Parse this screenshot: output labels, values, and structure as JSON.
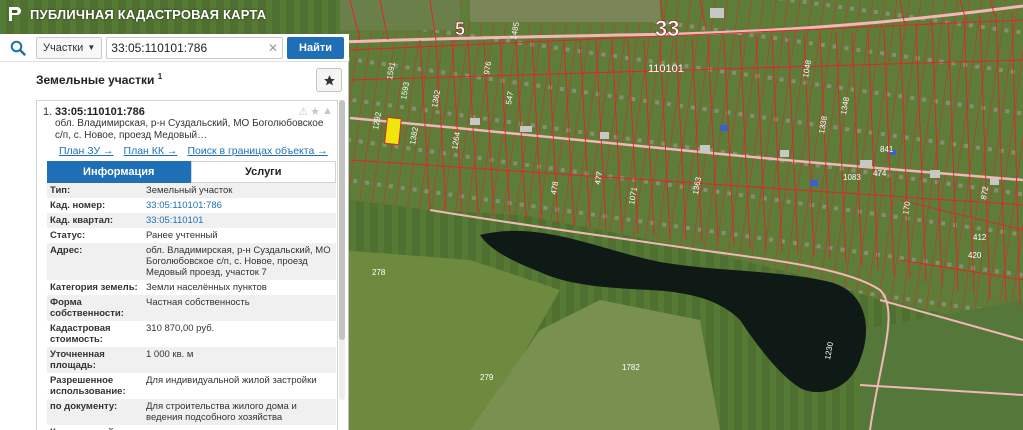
{
  "app": {
    "title": "ПУБЛИЧНАЯ КАДАСТРОВАЯ КАРТА"
  },
  "search": {
    "type_label": "Участки",
    "query": "33:05:110101:786",
    "find_label": "Найти"
  },
  "panel": {
    "title": "Земельные участки",
    "title_count": "1"
  },
  "result": {
    "number": "1.",
    "cad_number": "33:05:110101:786",
    "address": "обл. Владимирская, р-н Суздальский, МО Боголюбовское с/п, с. Новое, проезд Медовый…",
    "links": [
      "План ЗУ →",
      "План КК →",
      "Поиск в границах объекта →"
    ],
    "tabs": [
      "Информация",
      "Услуги"
    ],
    "attributes": [
      {
        "k": "Тип:",
        "v": "Земельный участок"
      },
      {
        "k": "Кад. номер:",
        "v": "33:05:110101:786",
        "link": true
      },
      {
        "k": "Кад. квартал:",
        "v": "33:05:110101",
        "link": true
      },
      {
        "k": "Статус:",
        "v": "Ранее учтенный"
      },
      {
        "k": "Адрес:",
        "v": "обл. Владимирская, р-н Суздальский, МО Боголюбовское с/п, с. Новое, проезд Медовый проезд, участок 7"
      },
      {
        "k": "Категория земель:",
        "v": "Земли населённых пунктов"
      },
      {
        "k": "Форма собственности:",
        "v": "Частная собственность"
      },
      {
        "k": "Кадастровая стоимость:",
        "v": "310 870,00 руб."
      },
      {
        "k": "Уточненная площадь:",
        "v": "1 000 кв. м"
      },
      {
        "k": "Разрешенное использование:",
        "v": "Для индивидуальной жилой застройки"
      },
      {
        "k": "по документу:",
        "v": "Для строительства жилого дома и ведения подсобного хозяйства"
      },
      {
        "k": "Кадастровый инженер:",
        "v": "-"
      }
    ]
  },
  "map": {
    "quarter_big": "33",
    "quarter_small": "5",
    "block_label": "110101",
    "parcel_labels": [
      "278",
      "279",
      "1782",
      "1363",
      "1071",
      "1083",
      "1048",
      "1338",
      "1348",
      "1230",
      "1485",
      "1362",
      "1591",
      "1593",
      "478",
      "477",
      "547",
      "976",
      "420",
      "412",
      "474",
      "841",
      "872",
      "170",
      "1382",
      "1264",
      "1292"
    ]
  },
  "colors": {
    "accent": "#1e6fb5",
    "parcel": "#e8202a",
    "road": "#f2b8b8"
  }
}
